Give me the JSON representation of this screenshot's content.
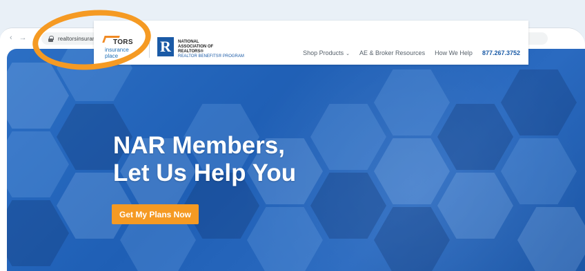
{
  "browser": {
    "url": "realtorsinsuranceplace.com"
  },
  "site": {
    "logo_realtors": "TORS",
    "logo_tagline": "insurance place",
    "nar_line1": "NATIONAL",
    "nar_line2": "ASSOCIATION OF",
    "nar_line3": "REALTORS®",
    "nar_line4": "REALTOR BENEFITS® PROGRAM",
    "nav": {
      "shop_products": "Shop Products",
      "ae_broker": "AE & Broker Resources",
      "how_we_help": "How We Help",
      "phone": "877.267.3752"
    }
  },
  "hero": {
    "headline_line1": "NAR Members,",
    "headline_line2": "Let Us Help You",
    "cta_label": "Get My Plans Now"
  },
  "annotation": {
    "color": "#f59a23"
  },
  "colors": {
    "brand_blue": "#1a5aa6",
    "cta_orange": "#f59a23"
  }
}
